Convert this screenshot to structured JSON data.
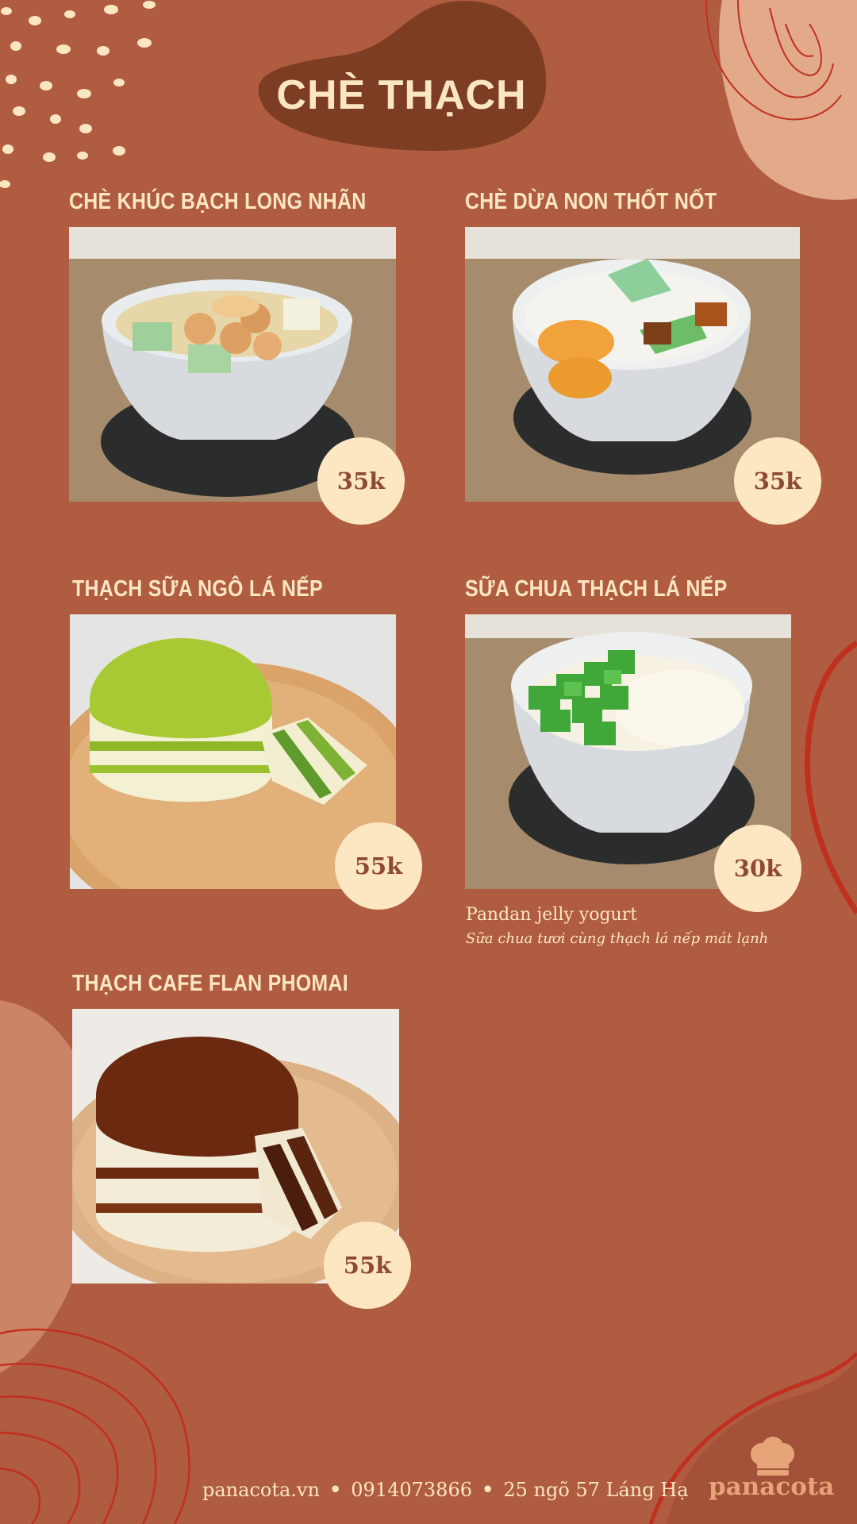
{
  "header": {
    "title": "CHÈ THẠCH"
  },
  "items": [
    {
      "name": "CHÈ KHÚC BẠCH LONG NHÃN",
      "price": "35k",
      "image": "bowl-longan-jelly"
    },
    {
      "name": "CHÈ DỪA NON THỐT NỐT",
      "price": "35k",
      "image": "bowl-coconut-jelly"
    },
    {
      "name": "THẠCH SỮA NGÔ LÁ NẾP",
      "price": "55k",
      "image": "layered-pandan-corn-jelly"
    },
    {
      "name": "SỮA CHUA THẠCH LÁ NẾP",
      "price": "30k",
      "image": "bowl-pandan-yogurt",
      "desc_en": "Pandan jelly yogurt",
      "desc_vi": "Sữa chua tươi cùng thạch lá nếp mát lạnh"
    },
    {
      "name": "THẠCH CAFE FLAN PHOMAI",
      "price": "55k",
      "image": "layered-coffee-flan"
    }
  ],
  "footer": {
    "website": "panacota.vn",
    "phone": "0914073866",
    "address": "25 ngõ 57 Láng Hạ",
    "separator": "•"
  },
  "brand": {
    "name": "panacota",
    "icon": "chef-hat-icon"
  },
  "colors": {
    "background": "#b05c40",
    "title_blob": "#7d3d22",
    "cream": "#fbe6c4",
    "price_badge": "#fde7c2",
    "price_text": "#8e4a33"
  }
}
